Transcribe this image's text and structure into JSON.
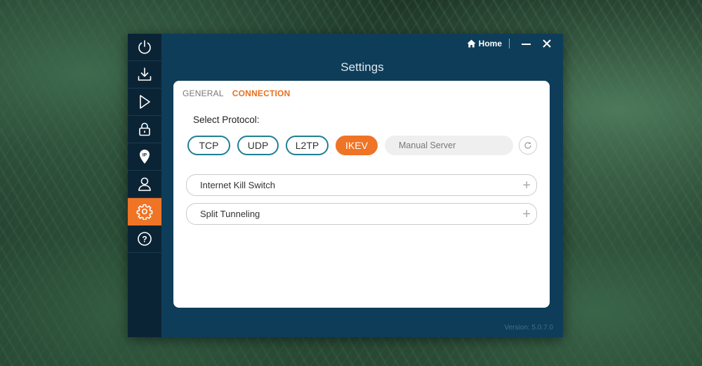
{
  "window": {
    "title": "Settings",
    "home_label": "Home",
    "version": "Version: 5.0.7.0"
  },
  "sidebar": {
    "items": [
      {
        "name": "power",
        "icon": "power-icon"
      },
      {
        "name": "download",
        "icon": "download-icon"
      },
      {
        "name": "play",
        "icon": "play-icon"
      },
      {
        "name": "lock",
        "icon": "lock-icon"
      },
      {
        "name": "ip",
        "icon": "ip-location-icon",
        "label": "IP"
      },
      {
        "name": "account",
        "icon": "user-icon"
      },
      {
        "name": "settings",
        "icon": "gear-icon",
        "active": true
      },
      {
        "name": "help",
        "icon": "help-icon",
        "label": "?"
      }
    ]
  },
  "tabs": [
    {
      "label": "GENERAL",
      "active": false
    },
    {
      "label": "CONNECTION",
      "active": true
    }
  ],
  "connection": {
    "select_protocol_label": "Select Protocol:",
    "protocols": [
      {
        "label": "TCP",
        "active": false
      },
      {
        "label": "UDP",
        "active": false
      },
      {
        "label": "L2TP",
        "active": false
      },
      {
        "label": "IKEV",
        "active": true
      }
    ],
    "manual_server_placeholder": "Manual Server",
    "options": [
      {
        "label": "Internet Kill Switch",
        "expander": "+"
      },
      {
        "label": "Split Tunneling",
        "expander": "+"
      }
    ]
  },
  "colors": {
    "accent": "#ef7426",
    "window_bg": "#0e3d59",
    "sidebar_bg": "#0b2435",
    "protocol_border": "#1e7f95"
  }
}
